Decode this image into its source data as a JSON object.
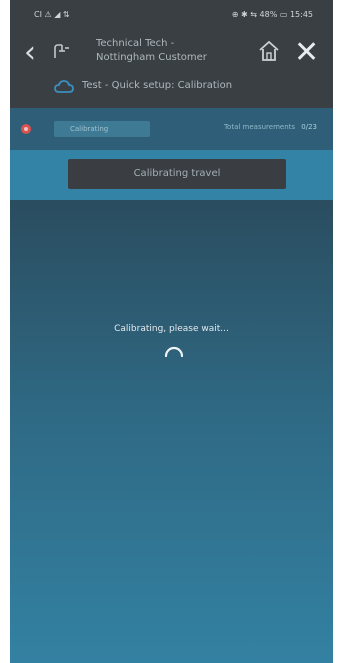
{
  "status_bar": {
    "left": "CI ⚠ ◢ ⇅",
    "right": "⊕ ✱ ⇆ 48% ▭ 15:45"
  },
  "header": {
    "line1": "Technical Tech -",
    "line2": "Nottingham Customer",
    "test_label": "Test - Quick setup: Calibration"
  },
  "info_bar": {
    "calibrating_badge": "Calibrating",
    "total_label": "Total measurements",
    "total_value": "0/23"
  },
  "action": {
    "button_label": "Calibrating travel"
  },
  "main": {
    "wait_text": "Calibrating, please wait..."
  },
  "colors": {
    "accent": "#3283a6",
    "header_bg": "#3a3f44"
  }
}
